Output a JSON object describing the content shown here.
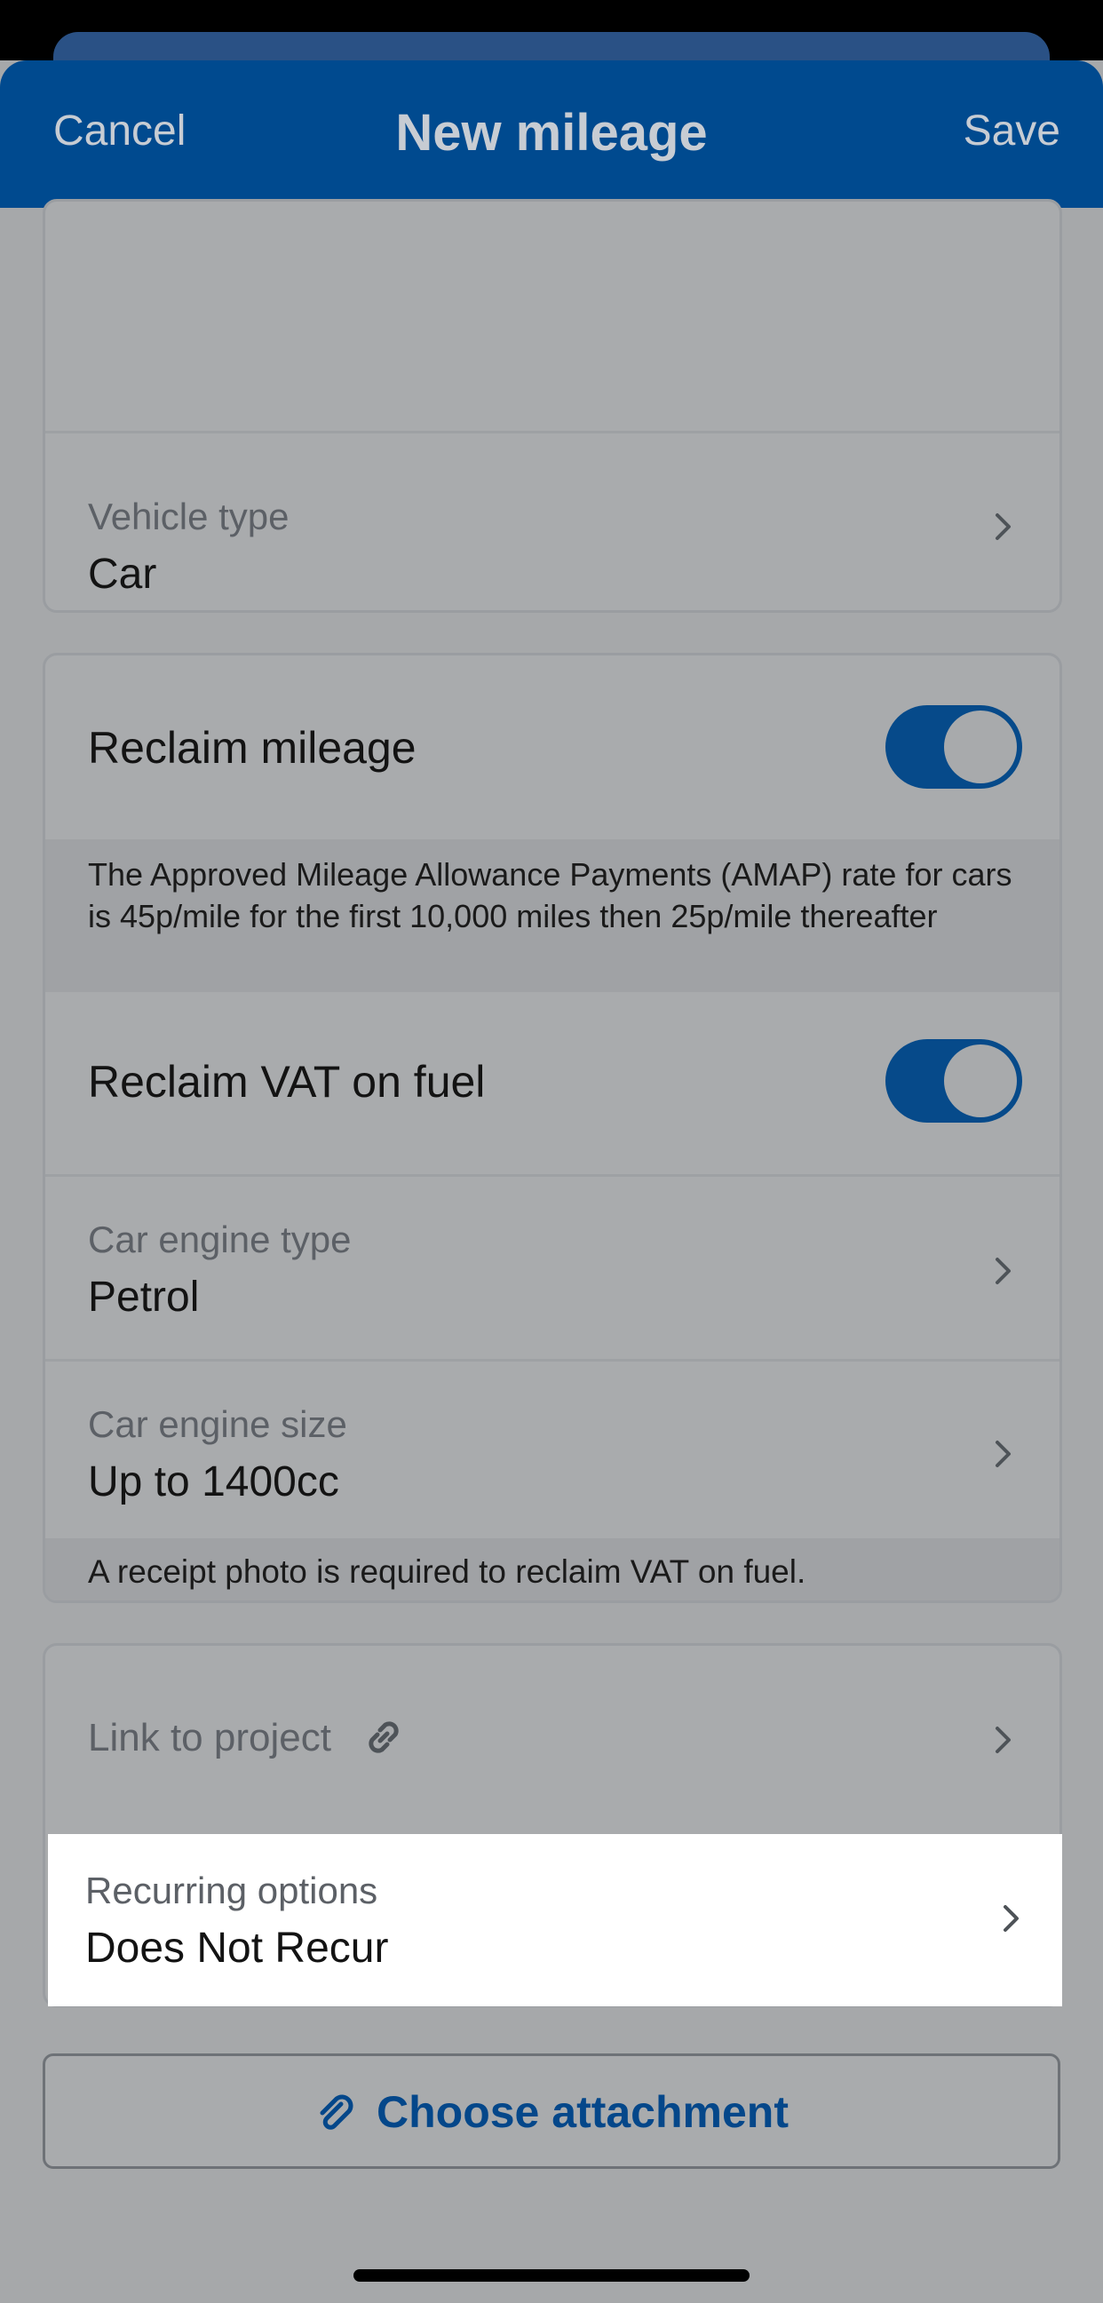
{
  "nav": {
    "cancel_label": "Cancel",
    "title": "New mileage",
    "save_label": "Save"
  },
  "vehicle": {
    "label": "Vehicle type",
    "value": "Car"
  },
  "reclaim": {
    "mileage_label": "Reclaim mileage",
    "mileage_on": true,
    "amap_note": "The Approved Mileage Allowance Payments (AMAP) rate for cars is 45p/mile for the first 10,000 miles then 25p/mile thereafter",
    "vat_label": "Reclaim VAT on fuel",
    "vat_on": true,
    "engine_type_label": "Car engine type",
    "engine_type_value": "Petrol",
    "engine_size_label": "Car engine size",
    "engine_size_value": "Up to 1400cc",
    "receipt_note": "A receipt photo is required to reclaim VAT on fuel."
  },
  "project": {
    "label": "Link to project",
    "icon": "link-icon"
  },
  "recurring": {
    "label": "Recurring options",
    "value": "Does Not Recur"
  },
  "attachment": {
    "label": "Choose attachment",
    "icon": "paperclip-icon"
  },
  "colors": {
    "brand": "#004a8f",
    "toggle_on": "#064a8a",
    "dimmed_background": "#a6a8aa"
  }
}
